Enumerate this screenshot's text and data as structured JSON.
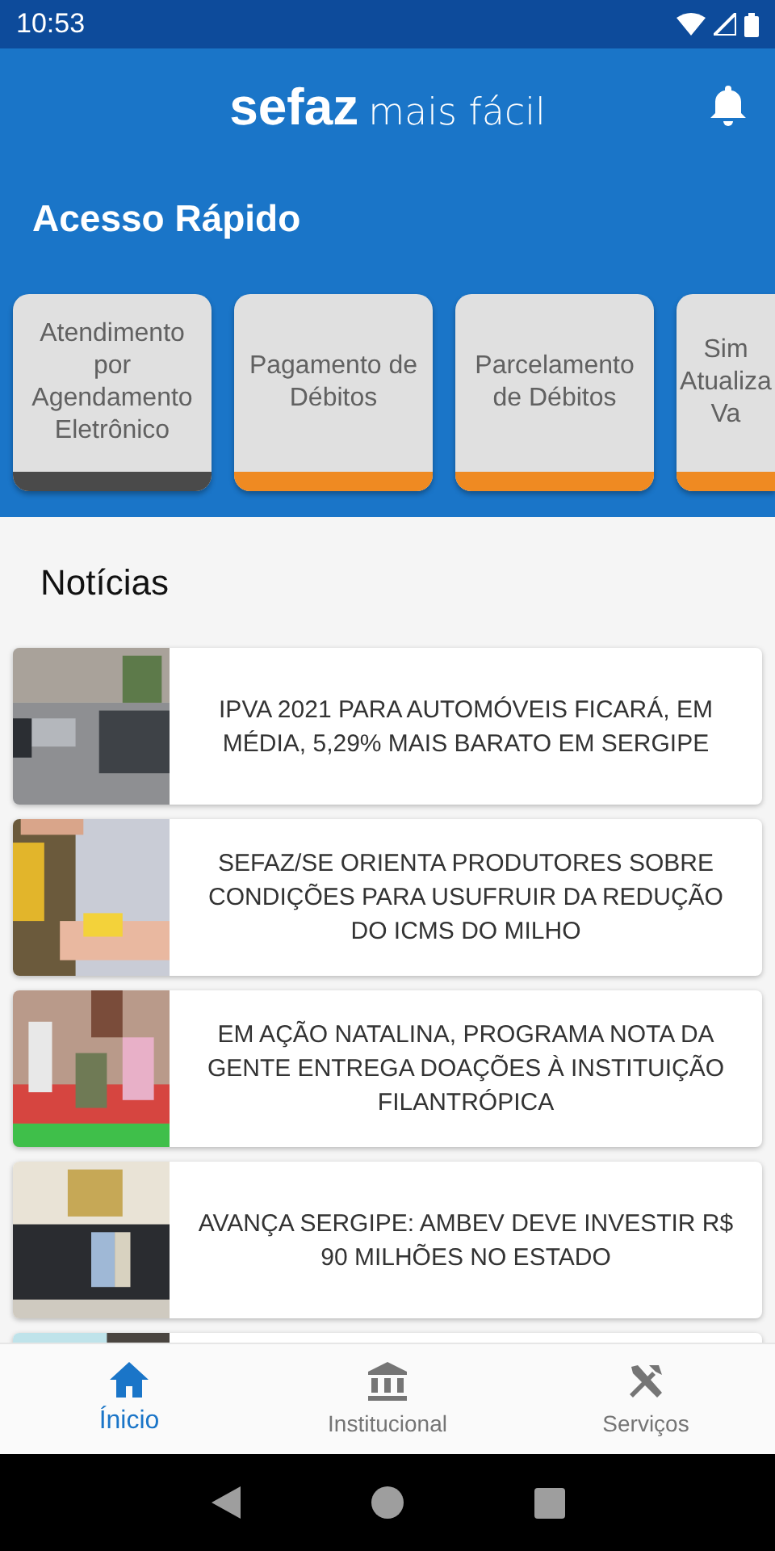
{
  "status_bar": {
    "time": "10:53"
  },
  "header": {
    "logo_bold": "sefaz",
    "logo_light": "mais fácil"
  },
  "quick_access": {
    "title": "Acesso Rápido",
    "items": [
      {
        "lines": [
          "Atendimento",
          "por",
          "Agendamento",
          "Eletrônico"
        ],
        "color": "#4a4a4a"
      },
      {
        "lines": [
          "Pagamento de",
          "Débitos"
        ],
        "color": "#ef8a22"
      },
      {
        "lines": [
          "Parcelamento",
          "de Débitos"
        ],
        "color": "#ef8a22"
      },
      {
        "lines": [
          "Sim",
          "Atualiza",
          "Va"
        ],
        "color": "#ef8a22"
      }
    ]
  },
  "news": {
    "title": "Notícias",
    "items": [
      {
        "kind": "picture",
        "title": "IPVA 2021 PARA AUTOMÓVEIS FICARÁ, EM MÉDIA, 5,29% MAIS BARATO EM SERGIPE"
      },
      {
        "kind": "picture",
        "title": "SEFAZ/SE ORIENTA PRODUTORES SOBRE CONDIÇÕES PARA USUFRUIR DA REDUÇÃO DO ICMS DO MILHO"
      },
      {
        "kind": "picture",
        "title": "EM AÇÃO NATALINA, PROGRAMA NOTA DA GENTE ENTREGA DOAÇÕES À INSTITUIÇÃO FILANTRÓPICA"
      },
      {
        "kind": "picture",
        "title": "AVANÇA SERGIPE: AMBEV DEVE INVESTIR R$ 90 MILHÕES NO ESTADO"
      },
      {
        "kind": "picture"
      }
    ]
  },
  "bottom_nav": [
    {
      "label": "Ínicio",
      "kind": "home",
      "selected": true
    },
    {
      "label": "Institucional",
      "kind": "bank",
      "selected": false
    },
    {
      "label": "Serviços",
      "kind": "tools",
      "selected": false
    }
  ]
}
